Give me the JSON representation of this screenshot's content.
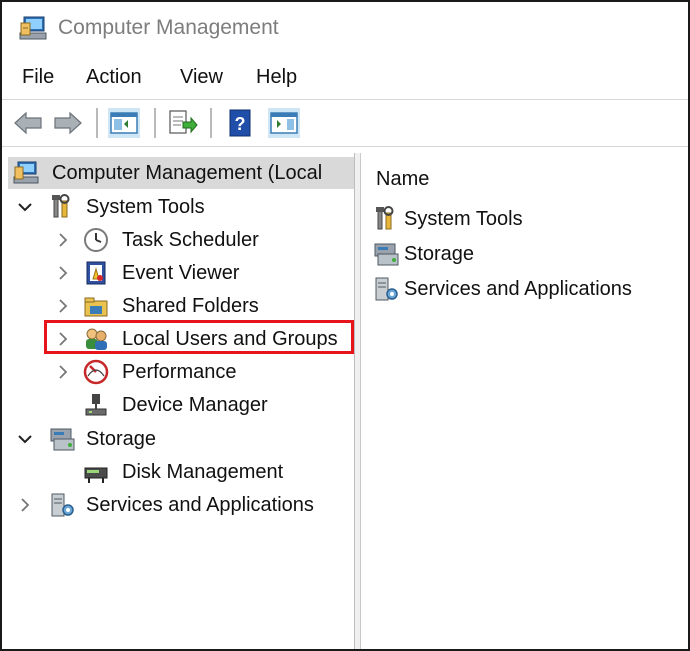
{
  "window": {
    "title": "Computer Management"
  },
  "menu": {
    "items": [
      "File",
      "Action",
      "View",
      "Help"
    ]
  },
  "toolbar": {
    "buttons": [
      "back-arrow-icon",
      "forward-arrow-icon",
      "show-hide-console-tree-icon",
      "export-list-icon",
      "help-icon",
      "show-hide-action-pane-icon"
    ]
  },
  "tree": {
    "root": "Computer Management (Local",
    "items": [
      {
        "label": "System Tools",
        "expanded": true,
        "level": 1,
        "icon": "tools-icon"
      },
      {
        "label": "Task Scheduler",
        "expanded": false,
        "level": 2,
        "icon": "clock-icon"
      },
      {
        "label": "Event Viewer",
        "expanded": false,
        "level": 2,
        "icon": "event-viewer-icon"
      },
      {
        "label": "Shared Folders",
        "expanded": false,
        "level": 2,
        "icon": "shared-folder-icon"
      },
      {
        "label": "Local Users and Groups",
        "expanded": false,
        "level": 2,
        "icon": "users-icon",
        "highlighted": true
      },
      {
        "label": "Performance",
        "expanded": false,
        "level": 2,
        "icon": "performance-icon"
      },
      {
        "label": "Device Manager",
        "level": 2,
        "icon": "device-manager-icon"
      },
      {
        "label": "Storage",
        "expanded": true,
        "level": 1,
        "icon": "storage-icon"
      },
      {
        "label": "Disk Management",
        "level": 2,
        "icon": "disk-icon"
      },
      {
        "label": "Services and Applications",
        "expanded": false,
        "level": 1,
        "icon": "services-icon"
      }
    ]
  },
  "list": {
    "column": "Name",
    "items": [
      {
        "label": "System Tools",
        "icon": "tools-icon"
      },
      {
        "label": "Storage",
        "icon": "storage-icon"
      },
      {
        "label": "Services and Applications",
        "icon": "services-icon"
      }
    ]
  },
  "colors": {
    "highlight_border": "#e8141b",
    "root_selection": "#d9d9d9",
    "title_text": "#7d7d7d"
  }
}
